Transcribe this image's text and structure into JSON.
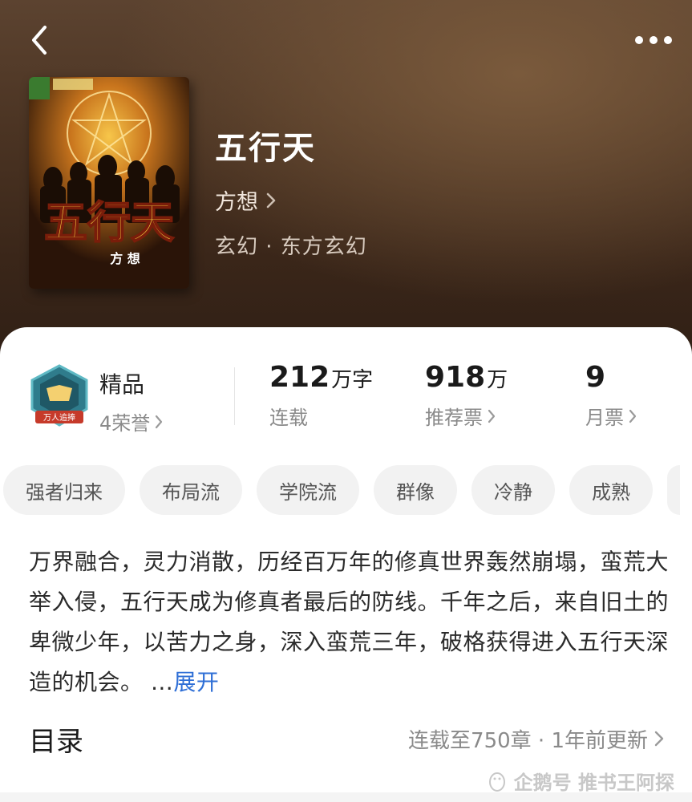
{
  "header": {
    "back_icon": "chevron-left-icon",
    "more_icon": "more-dots-icon"
  },
  "book": {
    "title": "五行天",
    "author": "方想",
    "genre": "玄幻 · 东方玄幻",
    "cover": {
      "title_art": "五行天",
      "author_art": "方 想"
    }
  },
  "stats": {
    "quality_label": "精品",
    "honors": "4荣誉",
    "badge_icon": "quality-shield-badge-icon",
    "badge_ribbon": "万人追捧",
    "word_count": "212",
    "word_unit": "万字",
    "serial_status": "连载",
    "recommend_votes": "918",
    "recommend_unit": "万",
    "recommend_label": "推荐票",
    "monthly_votes": "9",
    "monthly_label": "月票"
  },
  "tags": [
    "强者归来",
    "布局流",
    "学院流",
    "群像",
    "冷静",
    "成熟"
  ],
  "synopsis": {
    "text": "万界融合，灵力消散，历经百万年的修真世界轰然崩塌，蛮荒大举入侵，五行天成为修真者最后的防线。千年之后，来自旧土的卑微少年，以苦力之身，深入蛮荒三年，破格获得进入五行天深造的机会。 …",
    "expand_label": "展开"
  },
  "toc": {
    "title": "目录",
    "status": "连载至750章 · 1年前更新"
  },
  "watermark": {
    "text": "企鹅号 推书王阿探"
  },
  "colors": {
    "link": "#2f6fd6",
    "muted": "#8a8a8a",
    "header_bg": "#4b3423"
  }
}
